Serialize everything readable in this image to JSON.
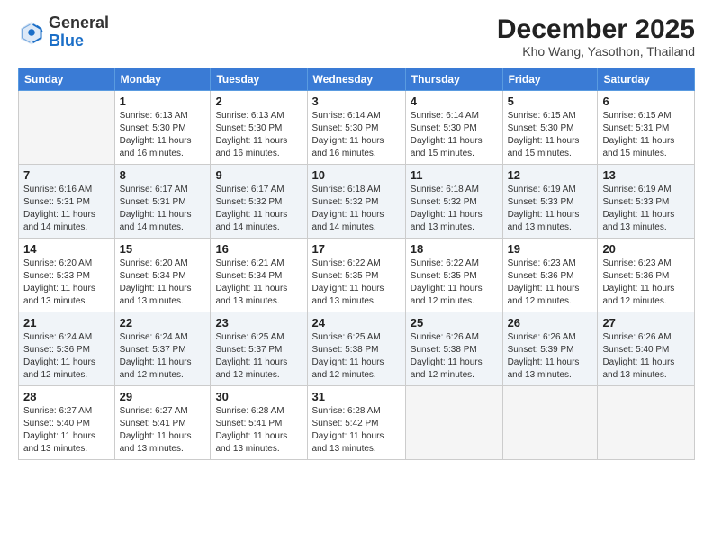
{
  "header": {
    "logo_general": "General",
    "logo_blue": "Blue",
    "month_year": "December 2025",
    "location": "Kho Wang, Yasothon, Thailand"
  },
  "days_of_week": [
    "Sunday",
    "Monday",
    "Tuesday",
    "Wednesday",
    "Thursday",
    "Friday",
    "Saturday"
  ],
  "weeks": [
    {
      "shaded": false,
      "days": [
        {
          "num": "",
          "sunrise": "",
          "sunset": "",
          "daylight": "",
          "empty": true
        },
        {
          "num": "1",
          "sunrise": "Sunrise: 6:13 AM",
          "sunset": "Sunset: 5:30 PM",
          "daylight": "Daylight: 11 hours and 16 minutes.",
          "empty": false
        },
        {
          "num": "2",
          "sunrise": "Sunrise: 6:13 AM",
          "sunset": "Sunset: 5:30 PM",
          "daylight": "Daylight: 11 hours and 16 minutes.",
          "empty": false
        },
        {
          "num": "3",
          "sunrise": "Sunrise: 6:14 AM",
          "sunset": "Sunset: 5:30 PM",
          "daylight": "Daylight: 11 hours and 16 minutes.",
          "empty": false
        },
        {
          "num": "4",
          "sunrise": "Sunrise: 6:14 AM",
          "sunset": "Sunset: 5:30 PM",
          "daylight": "Daylight: 11 hours and 15 minutes.",
          "empty": false
        },
        {
          "num": "5",
          "sunrise": "Sunrise: 6:15 AM",
          "sunset": "Sunset: 5:30 PM",
          "daylight": "Daylight: 11 hours and 15 minutes.",
          "empty": false
        },
        {
          "num": "6",
          "sunrise": "Sunrise: 6:15 AM",
          "sunset": "Sunset: 5:31 PM",
          "daylight": "Daylight: 11 hours and 15 minutes.",
          "empty": false
        }
      ]
    },
    {
      "shaded": true,
      "days": [
        {
          "num": "7",
          "sunrise": "Sunrise: 6:16 AM",
          "sunset": "Sunset: 5:31 PM",
          "daylight": "Daylight: 11 hours and 14 minutes.",
          "empty": false
        },
        {
          "num": "8",
          "sunrise": "Sunrise: 6:17 AM",
          "sunset": "Sunset: 5:31 PM",
          "daylight": "Daylight: 11 hours and 14 minutes.",
          "empty": false
        },
        {
          "num": "9",
          "sunrise": "Sunrise: 6:17 AM",
          "sunset": "Sunset: 5:32 PM",
          "daylight": "Daylight: 11 hours and 14 minutes.",
          "empty": false
        },
        {
          "num": "10",
          "sunrise": "Sunrise: 6:18 AM",
          "sunset": "Sunset: 5:32 PM",
          "daylight": "Daylight: 11 hours and 14 minutes.",
          "empty": false
        },
        {
          "num": "11",
          "sunrise": "Sunrise: 6:18 AM",
          "sunset": "Sunset: 5:32 PM",
          "daylight": "Daylight: 11 hours and 13 minutes.",
          "empty": false
        },
        {
          "num": "12",
          "sunrise": "Sunrise: 6:19 AM",
          "sunset": "Sunset: 5:33 PM",
          "daylight": "Daylight: 11 hours and 13 minutes.",
          "empty": false
        },
        {
          "num": "13",
          "sunrise": "Sunrise: 6:19 AM",
          "sunset": "Sunset: 5:33 PM",
          "daylight": "Daylight: 11 hours and 13 minutes.",
          "empty": false
        }
      ]
    },
    {
      "shaded": false,
      "days": [
        {
          "num": "14",
          "sunrise": "Sunrise: 6:20 AM",
          "sunset": "Sunset: 5:33 PM",
          "daylight": "Daylight: 11 hours and 13 minutes.",
          "empty": false
        },
        {
          "num": "15",
          "sunrise": "Sunrise: 6:20 AM",
          "sunset": "Sunset: 5:34 PM",
          "daylight": "Daylight: 11 hours and 13 minutes.",
          "empty": false
        },
        {
          "num": "16",
          "sunrise": "Sunrise: 6:21 AM",
          "sunset": "Sunset: 5:34 PM",
          "daylight": "Daylight: 11 hours and 13 minutes.",
          "empty": false
        },
        {
          "num": "17",
          "sunrise": "Sunrise: 6:22 AM",
          "sunset": "Sunset: 5:35 PM",
          "daylight": "Daylight: 11 hours and 13 minutes.",
          "empty": false
        },
        {
          "num": "18",
          "sunrise": "Sunrise: 6:22 AM",
          "sunset": "Sunset: 5:35 PM",
          "daylight": "Daylight: 11 hours and 12 minutes.",
          "empty": false
        },
        {
          "num": "19",
          "sunrise": "Sunrise: 6:23 AM",
          "sunset": "Sunset: 5:36 PM",
          "daylight": "Daylight: 11 hours and 12 minutes.",
          "empty": false
        },
        {
          "num": "20",
          "sunrise": "Sunrise: 6:23 AM",
          "sunset": "Sunset: 5:36 PM",
          "daylight": "Daylight: 11 hours and 12 minutes.",
          "empty": false
        }
      ]
    },
    {
      "shaded": true,
      "days": [
        {
          "num": "21",
          "sunrise": "Sunrise: 6:24 AM",
          "sunset": "Sunset: 5:36 PM",
          "daylight": "Daylight: 11 hours and 12 minutes.",
          "empty": false
        },
        {
          "num": "22",
          "sunrise": "Sunrise: 6:24 AM",
          "sunset": "Sunset: 5:37 PM",
          "daylight": "Daylight: 11 hours and 12 minutes.",
          "empty": false
        },
        {
          "num": "23",
          "sunrise": "Sunrise: 6:25 AM",
          "sunset": "Sunset: 5:37 PM",
          "daylight": "Daylight: 11 hours and 12 minutes.",
          "empty": false
        },
        {
          "num": "24",
          "sunrise": "Sunrise: 6:25 AM",
          "sunset": "Sunset: 5:38 PM",
          "daylight": "Daylight: 11 hours and 12 minutes.",
          "empty": false
        },
        {
          "num": "25",
          "sunrise": "Sunrise: 6:26 AM",
          "sunset": "Sunset: 5:38 PM",
          "daylight": "Daylight: 11 hours and 12 minutes.",
          "empty": false
        },
        {
          "num": "26",
          "sunrise": "Sunrise: 6:26 AM",
          "sunset": "Sunset: 5:39 PM",
          "daylight": "Daylight: 11 hours and 13 minutes.",
          "empty": false
        },
        {
          "num": "27",
          "sunrise": "Sunrise: 6:26 AM",
          "sunset": "Sunset: 5:40 PM",
          "daylight": "Daylight: 11 hours and 13 minutes.",
          "empty": false
        }
      ]
    },
    {
      "shaded": false,
      "days": [
        {
          "num": "28",
          "sunrise": "Sunrise: 6:27 AM",
          "sunset": "Sunset: 5:40 PM",
          "daylight": "Daylight: 11 hours and 13 minutes.",
          "empty": false
        },
        {
          "num": "29",
          "sunrise": "Sunrise: 6:27 AM",
          "sunset": "Sunset: 5:41 PM",
          "daylight": "Daylight: 11 hours and 13 minutes.",
          "empty": false
        },
        {
          "num": "30",
          "sunrise": "Sunrise: 6:28 AM",
          "sunset": "Sunset: 5:41 PM",
          "daylight": "Daylight: 11 hours and 13 minutes.",
          "empty": false
        },
        {
          "num": "31",
          "sunrise": "Sunrise: 6:28 AM",
          "sunset": "Sunset: 5:42 PM",
          "daylight": "Daylight: 11 hours and 13 minutes.",
          "empty": false
        },
        {
          "num": "",
          "sunrise": "",
          "sunset": "",
          "daylight": "",
          "empty": true
        },
        {
          "num": "",
          "sunrise": "",
          "sunset": "",
          "daylight": "",
          "empty": true
        },
        {
          "num": "",
          "sunrise": "",
          "sunset": "",
          "daylight": "",
          "empty": true
        }
      ]
    }
  ]
}
